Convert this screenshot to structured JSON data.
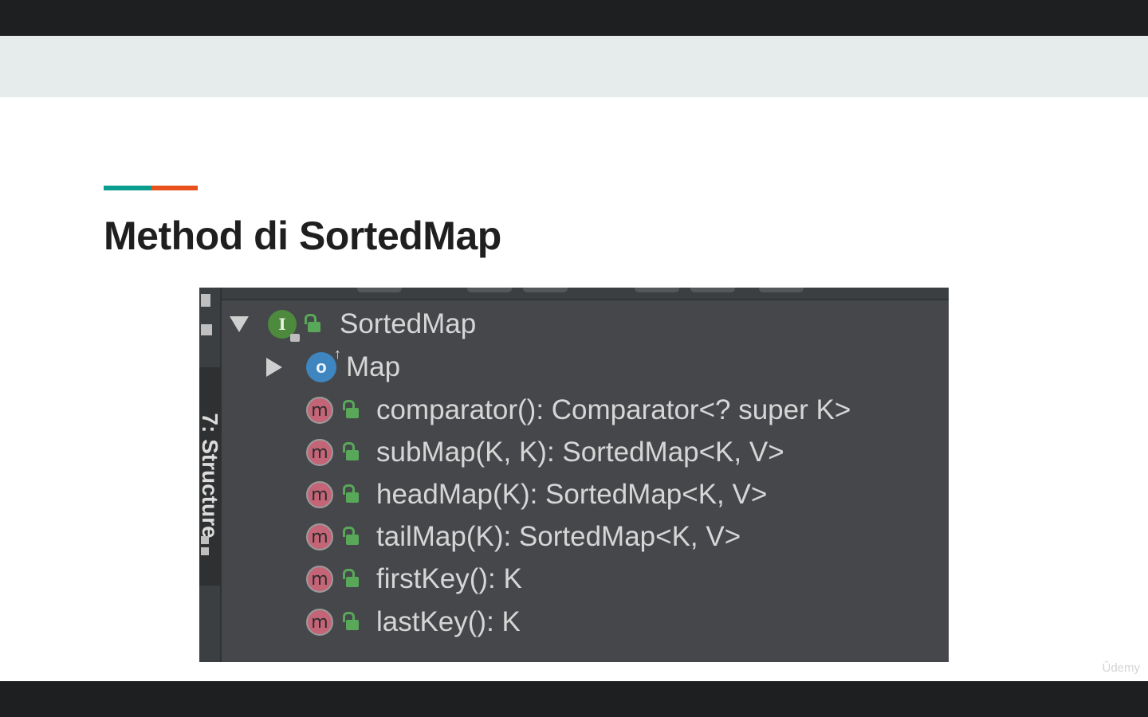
{
  "slide": {
    "title": "Method di SortedMap",
    "watermark": "Ûdemy",
    "accent_colors": [
      "#0b9e8f",
      "#e8501c"
    ]
  },
  "ide_panel": {
    "side_tab_label": "7: Structure",
    "root": {
      "label": "SortedMap",
      "icon": "interface-icon",
      "icon_letter": "I",
      "expanded": true
    },
    "parent": {
      "label": "Map",
      "icon": "class-icon",
      "icon_letter": "o",
      "expanded": false
    },
    "method_icon_letter": "m",
    "methods": [
      {
        "signature": "comparator(): Comparator<? super K>"
      },
      {
        "signature": "subMap(K, K): SortedMap<K, V>"
      },
      {
        "signature": "headMap(K): SortedMap<K, V>"
      },
      {
        "signature": "tailMap(K): SortedMap<K, V>"
      },
      {
        "signature": "firstKey(): K"
      },
      {
        "signature": "lastKey(): K"
      }
    ]
  }
}
